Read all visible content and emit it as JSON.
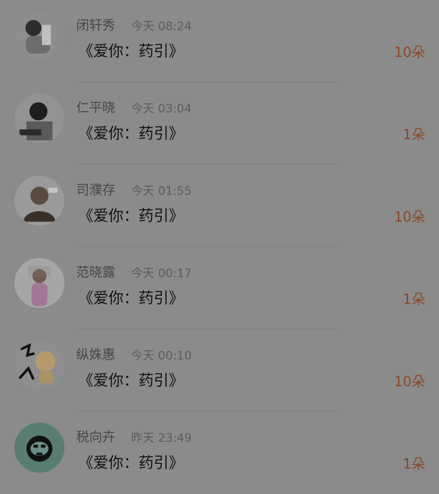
{
  "records": [
    {
      "name": "闭轩秀",
      "time": "今天 08:24",
      "gift": "《爱你：药引》",
      "count": "10朵"
    },
    {
      "name": "仁平晓",
      "time": "今天 03:04",
      "gift": "《爱你：药引》",
      "count": "1朵"
    },
    {
      "name": "司濮存",
      "time": "今天 01:55",
      "gift": "《爱你：药引》",
      "count": "10朵"
    },
    {
      "name": "范晓露",
      "time": "今天 00:17",
      "gift": "《爱你：药引》",
      "count": "1朵"
    },
    {
      "name": "纵姝惠",
      "time": "今天 00:10",
      "gift": "《爱你：药引》",
      "count": "10朵"
    },
    {
      "name": "税向卉",
      "time": "昨天 23:49",
      "gift": "《爱你：药引》",
      "count": "1朵"
    }
  ],
  "colors": {
    "background": "#8b8b8b",
    "name": "#474747",
    "time": "#5c5c5c",
    "gift": "#111111",
    "count": "#87492a"
  }
}
